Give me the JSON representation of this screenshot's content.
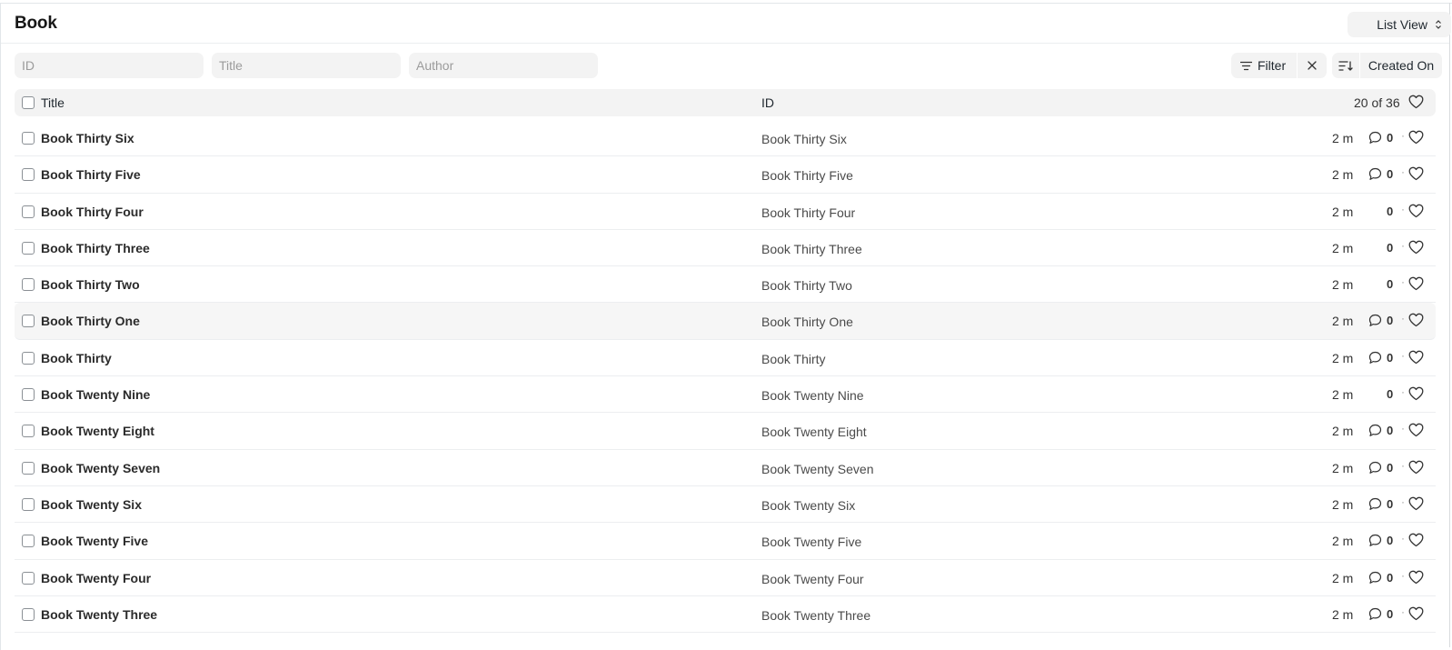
{
  "header": {
    "title": "Book",
    "view_label": "List View"
  },
  "filters": {
    "id_placeholder": "ID",
    "title_placeholder": "Title",
    "author_placeholder": "Author",
    "filter_label": "Filter",
    "sort_label": "Created On"
  },
  "list": {
    "col_title": "Title",
    "col_id": "ID",
    "count": "20 of 36",
    "rows": [
      {
        "title": "Book Thirty Six",
        "id": "Book Thirty Six",
        "time": "2 m",
        "comments": "0",
        "has_comment_icon": true
      },
      {
        "title": "Book Thirty Five",
        "id": "Book Thirty Five",
        "time": "2 m",
        "comments": "0",
        "has_comment_icon": true
      },
      {
        "title": "Book Thirty Four",
        "id": "Book Thirty Four",
        "time": "2 m",
        "comments": "0",
        "has_comment_icon": false
      },
      {
        "title": "Book Thirty Three",
        "id": "Book Thirty Three",
        "time": "2 m",
        "comments": "0",
        "has_comment_icon": false
      },
      {
        "title": "Book Thirty Two",
        "id": "Book Thirty Two",
        "time": "2 m",
        "comments": "0",
        "has_comment_icon": false
      },
      {
        "title": "Book Thirty One",
        "id": "Book Thirty One",
        "time": "2 m",
        "comments": "0",
        "has_comment_icon": true
      },
      {
        "title": "Book Thirty",
        "id": "Book Thirty",
        "time": "2 m",
        "comments": "0",
        "has_comment_icon": true
      },
      {
        "title": "Book Twenty Nine",
        "id": "Book Twenty Nine",
        "time": "2 m",
        "comments": "0",
        "has_comment_icon": false
      },
      {
        "title": "Book Twenty Eight",
        "id": "Book Twenty Eight",
        "time": "2 m",
        "comments": "0",
        "has_comment_icon": true
      },
      {
        "title": "Book Twenty Seven",
        "id": "Book Twenty Seven",
        "time": "2 m",
        "comments": "0",
        "has_comment_icon": true
      },
      {
        "title": "Book Twenty Six",
        "id": "Book Twenty Six",
        "time": "2 m",
        "comments": "0",
        "has_comment_icon": true
      },
      {
        "title": "Book Twenty Five",
        "id": "Book Twenty Five",
        "time": "2 m",
        "comments": "0",
        "has_comment_icon": true
      },
      {
        "title": "Book Twenty Four",
        "id": "Book Twenty Four",
        "time": "2 m",
        "comments": "0",
        "has_comment_icon": true
      },
      {
        "title": "Book Twenty Three",
        "id": "Book Twenty Three",
        "time": "2 m",
        "comments": "0",
        "has_comment_icon": true
      }
    ]
  },
  "icons": {
    "filter": "filter-icon",
    "clear": "close-icon",
    "sort": "sort-descending-icon",
    "like": "heart-icon",
    "comment": "comment-icon",
    "view_switch": "updown-chevron-icon"
  }
}
